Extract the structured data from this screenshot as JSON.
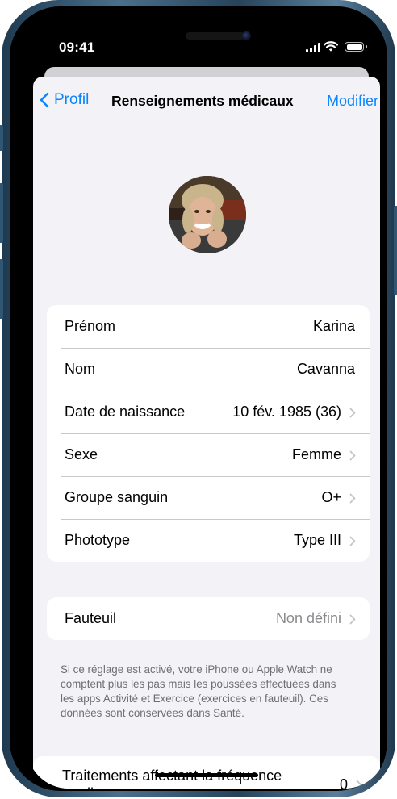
{
  "status_bar": {
    "time": "09:41"
  },
  "nav": {
    "back_label": "Profil",
    "title": "Renseignements médicaux",
    "edit_label": "Modifier"
  },
  "profile_rows": [
    {
      "label": "Prénom",
      "value": "Karina"
    },
    {
      "label": "Nom",
      "value": "Cavanna"
    },
    {
      "label": "Date de naissance",
      "value": "10 fév. 1985 (36)"
    },
    {
      "label": "Sexe",
      "value": "Femme"
    },
    {
      "label": "Groupe sanguin",
      "value": "O+"
    },
    {
      "label": "Phototype",
      "value": "Type III"
    }
  ],
  "wheelchair": {
    "label": "Fauteuil",
    "value": "Non défini",
    "footnote": "Si ce réglage est activé, votre iPhone ou Apple Watch ne comptent plus les pas mais les poussées effectuées dans les apps Activité et Exercice (exercices en fauteuil). Ces données sont conservées dans Santé."
  },
  "medications": {
    "label": "Traitements affectant la fréquence cardiaque",
    "value": "0"
  },
  "colors": {
    "accent": "#0a84ff",
    "background": "#f2f2f7",
    "frame": "#3a5f7c"
  },
  "icons": [
    "chevron-left-icon",
    "chevron-right-icon",
    "cellular-icon",
    "wifi-icon",
    "battery-icon"
  ]
}
